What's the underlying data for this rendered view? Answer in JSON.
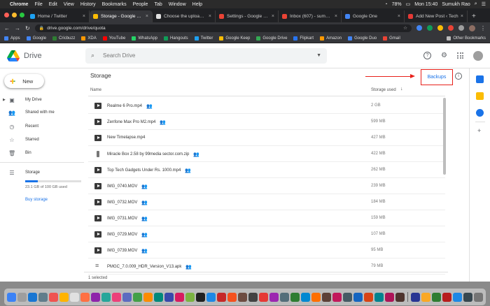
{
  "menubar": {
    "apple": "",
    "items": [
      "Chrome",
      "File",
      "Edit",
      "View",
      "History",
      "Bookmarks",
      "People",
      "Tab",
      "Window",
      "Help"
    ],
    "battery": "78%",
    "time": "Mon 15:40",
    "user": "Sumukh Rao"
  },
  "tabs": [
    {
      "title": "Home / Twitter",
      "color": "#1da1f2"
    },
    {
      "title": "Storage - Google Drive",
      "color": "#fbbc04"
    },
    {
      "title": "Choose the upload size",
      "color": "#e0e0e0"
    },
    {
      "title": "Settings - Google Photos",
      "color": "#ea4335"
    },
    {
      "title": "Inbox (607) - sumukh",
      "color": "#ea4335"
    },
    {
      "title": "Google One",
      "color": "#4285f4"
    },
    {
      "title": "Add New Post ‹ Tech",
      "color": "#e53935"
    }
  ],
  "address": {
    "url": "drive.google.com/drive/quota"
  },
  "bookmarks": [
    {
      "label": "Apps",
      "color": "#4285f4"
    },
    {
      "label": "Google",
      "color": "#4285f4"
    },
    {
      "label": "Cricbuzz",
      "color": "#2e7d32"
    },
    {
      "label": "XDA",
      "color": "#ff9800"
    },
    {
      "label": "YouTube",
      "color": "#ff0000"
    },
    {
      "label": "WhatsApp",
      "color": "#25d366"
    },
    {
      "label": "Hangouts",
      "color": "#0f9d58"
    },
    {
      "label": "Twitter",
      "color": "#1da1f2"
    },
    {
      "label": "Google Keep",
      "color": "#fbbc04"
    },
    {
      "label": "Google Drive",
      "color": "#34a853"
    },
    {
      "label": "Flipkart",
      "color": "#2874f0"
    },
    {
      "label": "Amazon",
      "color": "#ff9900"
    },
    {
      "label": "Google Duo",
      "color": "#4285f4"
    },
    {
      "label": "Gmail",
      "color": "#ea4335"
    }
  ],
  "bookmarks_other": "Other Bookmarks",
  "drive": {
    "logo_text": "Drive",
    "search_placeholder": "Search Drive",
    "new_label": "New",
    "nav": [
      {
        "label": "My Drive",
        "icon": "drive-icon",
        "glyph": "▣"
      },
      {
        "label": "Shared with me",
        "icon": "people-icon",
        "glyph": "👥"
      },
      {
        "label": "Recent",
        "icon": "clock-icon",
        "glyph": "◷"
      },
      {
        "label": "Starred",
        "icon": "star-icon",
        "glyph": "☆"
      },
      {
        "label": "Bin",
        "icon": "trash-icon",
        "glyph": "🗑"
      }
    ],
    "storage_label": "Storage",
    "storage_used_text": "23.1 GB of 100 GB used",
    "storage_fraction": 0.231,
    "buy_storage": "Buy storage",
    "page_title": "Storage",
    "backups_label": "Backups",
    "col_name": "Name",
    "col_storage": "Storage used",
    "files": [
      {
        "name": "Realme 6 Pro.mp4",
        "type": "video",
        "shared": true,
        "size": "2 GB"
      },
      {
        "name": "Zenfone Max Pro M2.mp4",
        "type": "video",
        "shared": true,
        "size": "599 MB"
      },
      {
        "name": "New Timelapse.mp4",
        "type": "video",
        "shared": false,
        "size": "427 MB"
      },
      {
        "name": "Miracle Box 2.58 by 99media sector.com.zip",
        "type": "zip",
        "shared": true,
        "size": "422 MB"
      },
      {
        "name": "Top Tech Gadgets Under Rs. 1000.mp4",
        "type": "video",
        "shared": true,
        "size": "262 MB"
      },
      {
        "name": "IMG_0740.MOV",
        "type": "video",
        "shared": true,
        "size": "239 MB"
      },
      {
        "name": "IMG_0732.MOV",
        "type": "video",
        "shared": true,
        "size": "184 MB"
      },
      {
        "name": "IMG_0731.MOV",
        "type": "video",
        "shared": true,
        "size": "159 MB"
      },
      {
        "name": "IMG_0729.MOV",
        "type": "video",
        "shared": true,
        "size": "107 MB"
      },
      {
        "name": "IMG_0739.MOV",
        "type": "video",
        "shared": true,
        "size": "95 MB"
      },
      {
        "name": "PMGC_7.0.009_HDR_Version_V13.apk",
        "type": "apk",
        "shared": true,
        "size": "79 MB"
      }
    ],
    "footer": "1 selected"
  }
}
